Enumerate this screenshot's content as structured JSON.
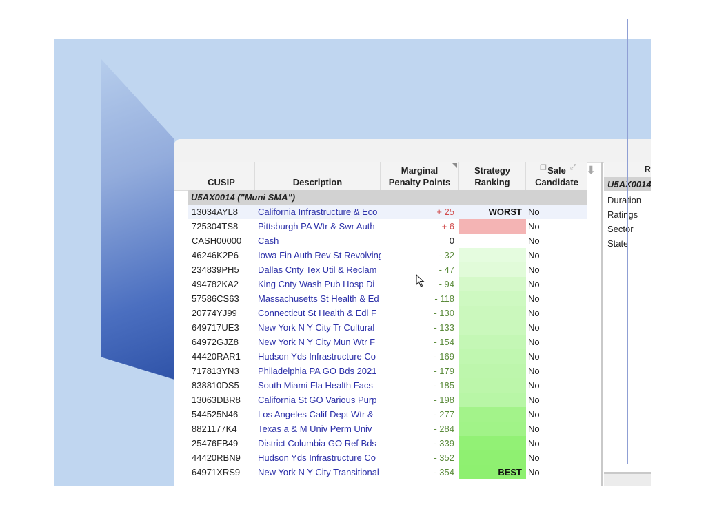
{
  "grid": {
    "headers": {
      "cusip": "CUSIP",
      "description": "Description",
      "penalty_line1": "Marginal",
      "penalty_line2": "Penalty Points",
      "rank_line1": "Strategy",
      "rank_line2": "Ranking",
      "sale_line1": "Sale",
      "sale_line2": "Candidate"
    },
    "header_icons": [
      "restore-icon",
      "expand-icon",
      "download-arrow-icon"
    ],
    "group_label": "U5AX0014 (\"Muni SMA\")",
    "rank_gradient": {
      "worst_color": "#e06b6b",
      "bad_color": "#f4b4b4",
      "neutral_color": "#ffffff",
      "best_color": "#8ef070"
    },
    "rows": [
      {
        "cusip": "13034AYL8",
        "description": "California Infrastructure & Eco",
        "penalty": "+ 25",
        "sign": "pos",
        "rank_label": "WORST",
        "sale": "No"
      },
      {
        "cusip": "725304TS8",
        "description": "Pittsburgh PA Wtr & Swr Auth",
        "penalty": "+ 6",
        "sign": "pos",
        "rank_label": "",
        "sale": "No"
      },
      {
        "cusip": "CASH00000",
        "description": "Cash",
        "penalty": "0",
        "sign": "zero",
        "rank_label": "",
        "sale": "No"
      },
      {
        "cusip": "46246K2P6",
        "description": "Iowa Fin Auth Rev St Revolving",
        "penalty": "- 32",
        "sign": "neg",
        "rank_label": "",
        "sale": "No"
      },
      {
        "cusip": "234839PH5",
        "description": "Dallas Cnty Tex Util & Reclam",
        "penalty": "- 47",
        "sign": "neg",
        "rank_label": "",
        "sale": "No"
      },
      {
        "cusip": "494782KA2",
        "description": "King Cnty Wash Pub Hosp Di",
        "penalty": "- 94",
        "sign": "neg",
        "rank_label": "",
        "sale": "No"
      },
      {
        "cusip": "57586CS63",
        "description": "Massachusetts St Health & Ed",
        "penalty": "- 118",
        "sign": "neg",
        "rank_label": "",
        "sale": "No"
      },
      {
        "cusip": "20774YJ99",
        "description": "Connecticut St Health & Edl F",
        "penalty": "- 130",
        "sign": "neg",
        "rank_label": "",
        "sale": "No"
      },
      {
        "cusip": "649717UE3",
        "description": "New York N Y City Tr Cultural",
        "penalty": "- 133",
        "sign": "neg",
        "rank_label": "",
        "sale": "No"
      },
      {
        "cusip": "64972GJZ8",
        "description": "New York N Y City Mun Wtr F",
        "penalty": "- 154",
        "sign": "neg",
        "rank_label": "",
        "sale": "No"
      },
      {
        "cusip": "44420RAR1",
        "description": "Hudson Yds Infrastructure Co",
        "penalty": "- 169",
        "sign": "neg",
        "rank_label": "",
        "sale": "No"
      },
      {
        "cusip": "717813YN3",
        "description": "Philadelphia PA GO Bds 2021",
        "penalty": "- 179",
        "sign": "neg",
        "rank_label": "",
        "sale": "No"
      },
      {
        "cusip": "838810DS5",
        "description": "South Miami Fla Health Facs",
        "penalty": "- 185",
        "sign": "neg",
        "rank_label": "",
        "sale": "No"
      },
      {
        "cusip": "13063DBR8",
        "description": "California St GO Various Purp",
        "penalty": "- 198",
        "sign": "neg",
        "rank_label": "",
        "sale": "No"
      },
      {
        "cusip": "544525N46",
        "description": "Los Angeles Calif Dept Wtr &",
        "penalty": "- 277",
        "sign": "neg",
        "rank_label": "",
        "sale": "No"
      },
      {
        "cusip": "8821177K4",
        "description": "Texas a & M Univ Perm Univ",
        "penalty": "- 284",
        "sign": "neg",
        "rank_label": "",
        "sale": "No"
      },
      {
        "cusip": "25476FB49",
        "description": "District Columbia GO Ref Bds",
        "penalty": "- 339",
        "sign": "neg",
        "rank_label": "",
        "sale": "No"
      },
      {
        "cusip": "44420RBN9",
        "description": "Hudson Yds Infrastructure Co",
        "penalty": "- 352",
        "sign": "neg",
        "rank_label": "",
        "sale": "No"
      },
      {
        "cusip": "64971XRS9",
        "description": "New York N Y City Transitional",
        "penalty": "- 354",
        "sign": "neg",
        "rank_label": "BEST",
        "sale": "No"
      }
    ]
  },
  "side_panel": {
    "header": "R",
    "group_label": "U5AX0014",
    "items": [
      "Duration",
      "Ratings",
      "Sector",
      "State"
    ]
  }
}
